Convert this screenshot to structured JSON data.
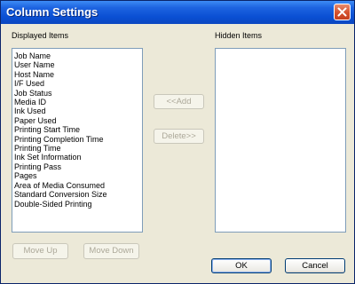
{
  "window": {
    "title": "Column Settings"
  },
  "displayed": {
    "label": "Displayed Items",
    "items": [
      "Job Name",
      "User Name",
      "Host Name",
      "I/F Used",
      "Job Status",
      "Media ID",
      "Ink Used",
      "Paper Used",
      "Printing Start Time",
      "Printing Completion Time",
      "Printing Time",
      "Ink Set Information",
      "Printing Pass",
      "Pages",
      "Area of Media Consumed",
      "Standard Conversion Size",
      "Double-Sided Printing"
    ]
  },
  "hidden": {
    "label": "Hidden Items",
    "items": []
  },
  "buttons": {
    "add": "<<Add",
    "delete": "Delete>>",
    "move_up": "Move Up",
    "move_down": "Move Down",
    "ok": "OK",
    "cancel": "Cancel"
  }
}
